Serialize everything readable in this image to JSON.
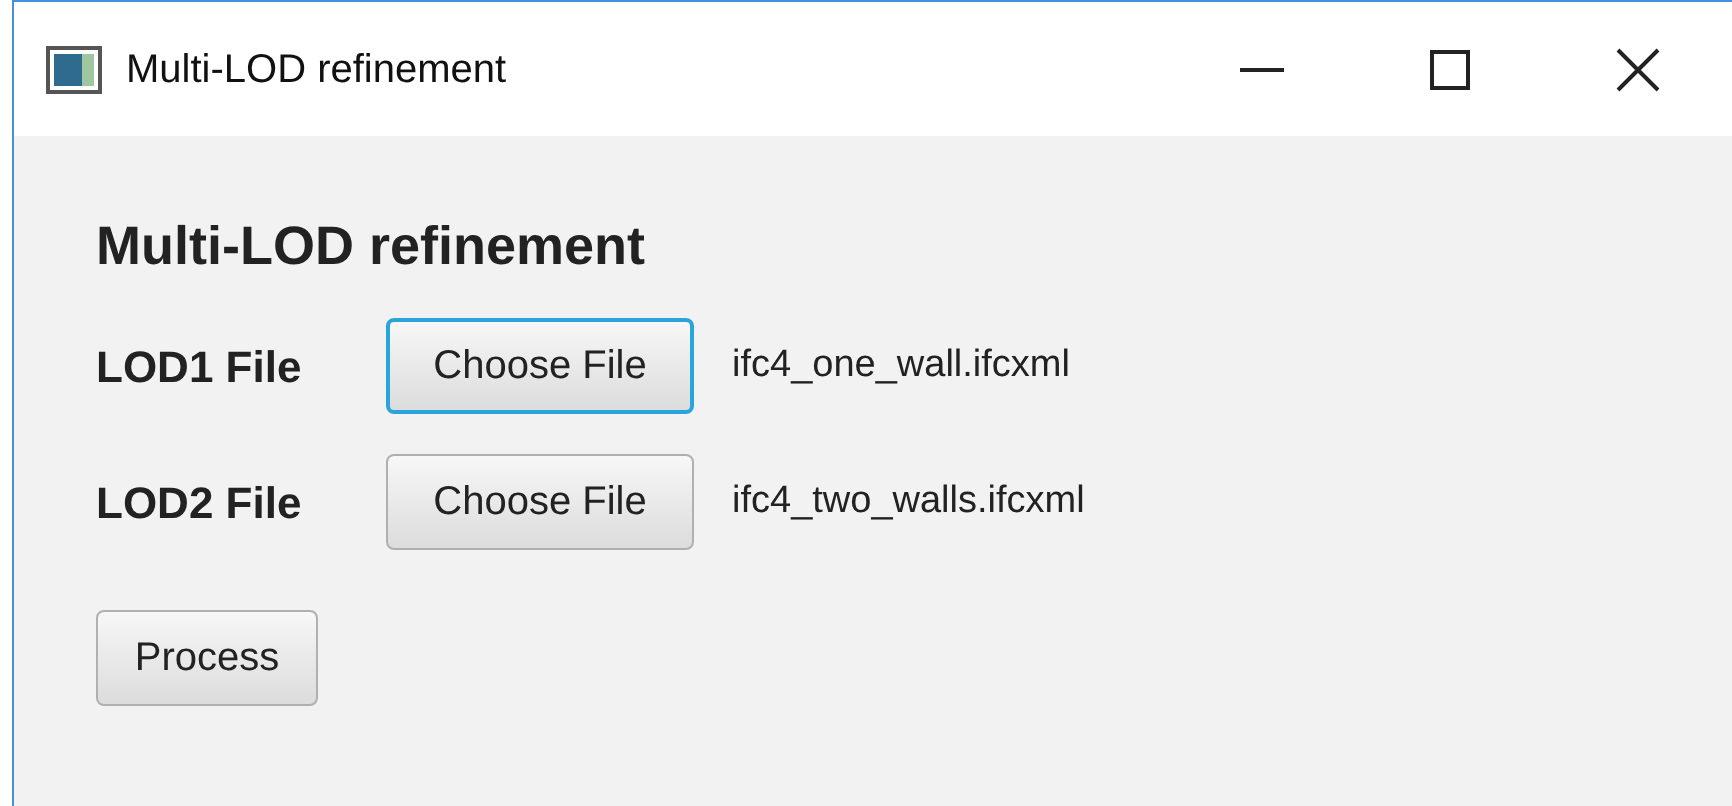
{
  "window": {
    "title": "Multi-LOD refinement"
  },
  "heading": "Multi-LOD refinement",
  "rows": [
    {
      "label": "LOD1 File",
      "button": "Choose File",
      "focused": true,
      "file": "ifc4_one_wall.ifcxml"
    },
    {
      "label": "LOD2 File",
      "button": "Choose File",
      "focused": false,
      "file": "ifc4_two_walls.ifcxml"
    }
  ],
  "process_button": "Process"
}
